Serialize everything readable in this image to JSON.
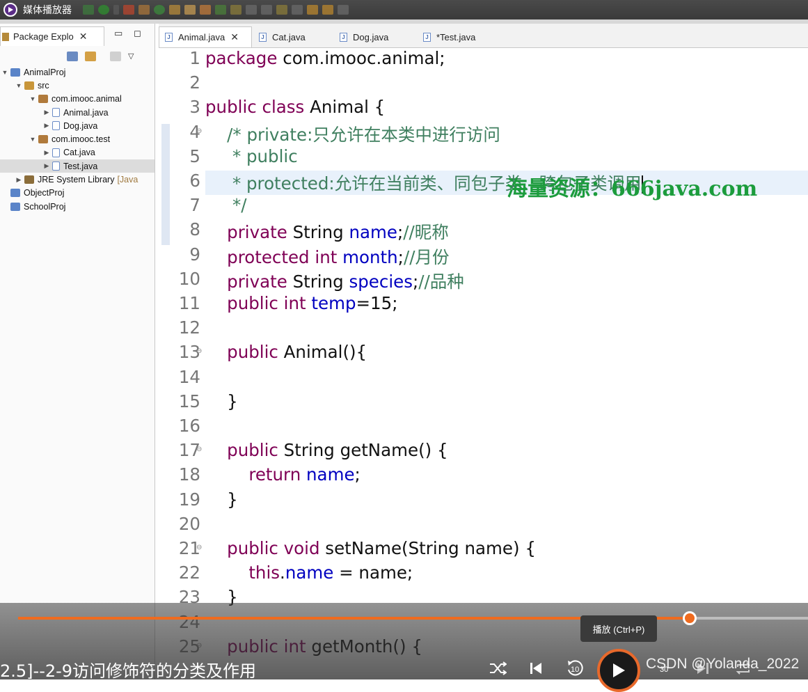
{
  "app": {
    "title": "媒体播放器"
  },
  "package_explorer": {
    "tab_label": "Package Explo",
    "tree": [
      {
        "label": "AnimalProj",
        "depth": 0,
        "twisty": "open",
        "icon": "project"
      },
      {
        "label": "src",
        "depth": 1,
        "twisty": "open",
        "icon": "source-folder"
      },
      {
        "label": "com.imooc.animal",
        "depth": 2,
        "twisty": "open",
        "icon": "package"
      },
      {
        "label": "Animal.java",
        "depth": 3,
        "twisty": "closed",
        "icon": "java-file"
      },
      {
        "label": "Dog.java",
        "depth": 3,
        "twisty": "closed",
        "icon": "java-file"
      },
      {
        "label": "com.imooc.test",
        "depth": 2,
        "twisty": "open",
        "icon": "package"
      },
      {
        "label": "Cat.java",
        "depth": 3,
        "twisty": "closed",
        "icon": "java-file"
      },
      {
        "label": "Test.java",
        "depth": 3,
        "twisty": "closed",
        "icon": "java-file",
        "selected": true
      },
      {
        "label": "JRE System Library",
        "suffix": "[Java",
        "depth": 1,
        "twisty": "closed",
        "icon": "library"
      },
      {
        "label": "ObjectProj",
        "depth": 0,
        "twisty": "none",
        "icon": "project"
      },
      {
        "label": "SchoolProj",
        "depth": 0,
        "twisty": "none",
        "icon": "project"
      }
    ]
  },
  "editor": {
    "tabs": [
      {
        "label": "Animal.java",
        "active": true,
        "closable": true
      },
      {
        "label": "Cat.java",
        "active": false
      },
      {
        "label": "Dog.java",
        "active": false
      },
      {
        "label": "*Test.java",
        "active": false
      }
    ],
    "lines": [
      {
        "n": "1",
        "segs": [
          [
            "kw",
            "package"
          ],
          [
            "t",
            " com.imooc.animal;"
          ]
        ]
      },
      {
        "n": "2",
        "segs": []
      },
      {
        "n": "3",
        "segs": [
          [
            "kw",
            "public class"
          ],
          [
            "t",
            " Animal {"
          ]
        ]
      },
      {
        "n": "4",
        "fold": true,
        "segs": [
          [
            "cm",
            "    /* private:只允许在本类中进行访问"
          ]
        ]
      },
      {
        "n": "5",
        "segs": [
          [
            "cm",
            "     * public"
          ]
        ]
      },
      {
        "n": "6",
        "highlight": true,
        "cursor": true,
        "segs": [
          [
            "cm",
            "     * protected:允许在当前类、同包子类、跨包子类调用"
          ]
        ]
      },
      {
        "n": "7",
        "segs": [
          [
            "cm",
            "     */"
          ]
        ]
      },
      {
        "n": "8",
        "segs": [
          [
            "t",
            "    "
          ],
          [
            "kw",
            "private"
          ],
          [
            "t",
            " String "
          ],
          [
            "fd",
            "name"
          ],
          [
            "t",
            ";"
          ],
          [
            "cm",
            "//昵称"
          ]
        ]
      },
      {
        "n": "9",
        "segs": [
          [
            "t",
            "    "
          ],
          [
            "kw",
            "protected int"
          ],
          [
            "t",
            " "
          ],
          [
            "fd",
            "month"
          ],
          [
            "t",
            ";"
          ],
          [
            "cm",
            "//月份"
          ]
        ]
      },
      {
        "n": "10",
        "segs": [
          [
            "t",
            "    "
          ],
          [
            "kw",
            "private"
          ],
          [
            "t",
            " String "
          ],
          [
            "fd",
            "species"
          ],
          [
            "t",
            ";"
          ],
          [
            "cm",
            "//品种"
          ]
        ]
      },
      {
        "n": "11",
        "segs": [
          [
            "t",
            "    "
          ],
          [
            "kw",
            "public int"
          ],
          [
            "t",
            " "
          ],
          [
            "fd",
            "temp"
          ],
          [
            "t",
            "=15;"
          ]
        ]
      },
      {
        "n": "12",
        "segs": []
      },
      {
        "n": "13",
        "fold": true,
        "segs": [
          [
            "t",
            "    "
          ],
          [
            "kw",
            "public"
          ],
          [
            "t",
            " Animal(){"
          ]
        ]
      },
      {
        "n": "14",
        "segs": []
      },
      {
        "n": "15",
        "segs": [
          [
            "t",
            "    }"
          ]
        ]
      },
      {
        "n": "16",
        "segs": []
      },
      {
        "n": "17",
        "fold": true,
        "segs": [
          [
            "t",
            "    "
          ],
          [
            "kw",
            "public"
          ],
          [
            "t",
            " String getName() {"
          ]
        ]
      },
      {
        "n": "18",
        "segs": [
          [
            "t",
            "        "
          ],
          [
            "kw",
            "return"
          ],
          [
            "t",
            " "
          ],
          [
            "fd",
            "name"
          ],
          [
            "t",
            ";"
          ]
        ]
      },
      {
        "n": "19",
        "segs": [
          [
            "t",
            "    }"
          ]
        ]
      },
      {
        "n": "20",
        "segs": []
      },
      {
        "n": "21",
        "fold": true,
        "segs": [
          [
            "t",
            "    "
          ],
          [
            "kw",
            "public void"
          ],
          [
            "t",
            " setName(String name) {"
          ]
        ]
      },
      {
        "n": "22",
        "segs": [
          [
            "t",
            "        "
          ],
          [
            "kw",
            "this"
          ],
          [
            "t",
            "."
          ],
          [
            "fd",
            "name"
          ],
          [
            "t",
            " = name;"
          ]
        ]
      },
      {
        "n": "23",
        "segs": [
          [
            "t",
            "    }"
          ]
        ]
      },
      {
        "n": "24",
        "segs": []
      },
      {
        "n": "25",
        "fold": true,
        "segs": [
          [
            "t",
            "    "
          ],
          [
            "kw",
            "public int"
          ],
          [
            "t",
            " getMonth() {"
          ]
        ]
      }
    ]
  },
  "watermark": {
    "text": "海量资源：666java.com"
  },
  "player": {
    "progress": 0.85,
    "tooltip": "播放 (Ctrl+P)",
    "video_title": "2.5]--2-9访问修饰符的分类及作用",
    "rewind_label": "10",
    "forward_label": "30",
    "overlay_text": "CSDN @Yolanda_2022"
  },
  "colors": {
    "keyword": "#7f0055",
    "field": "#0000c0",
    "comment": "#3f7f5f",
    "accent": "#ef6b1f"
  }
}
